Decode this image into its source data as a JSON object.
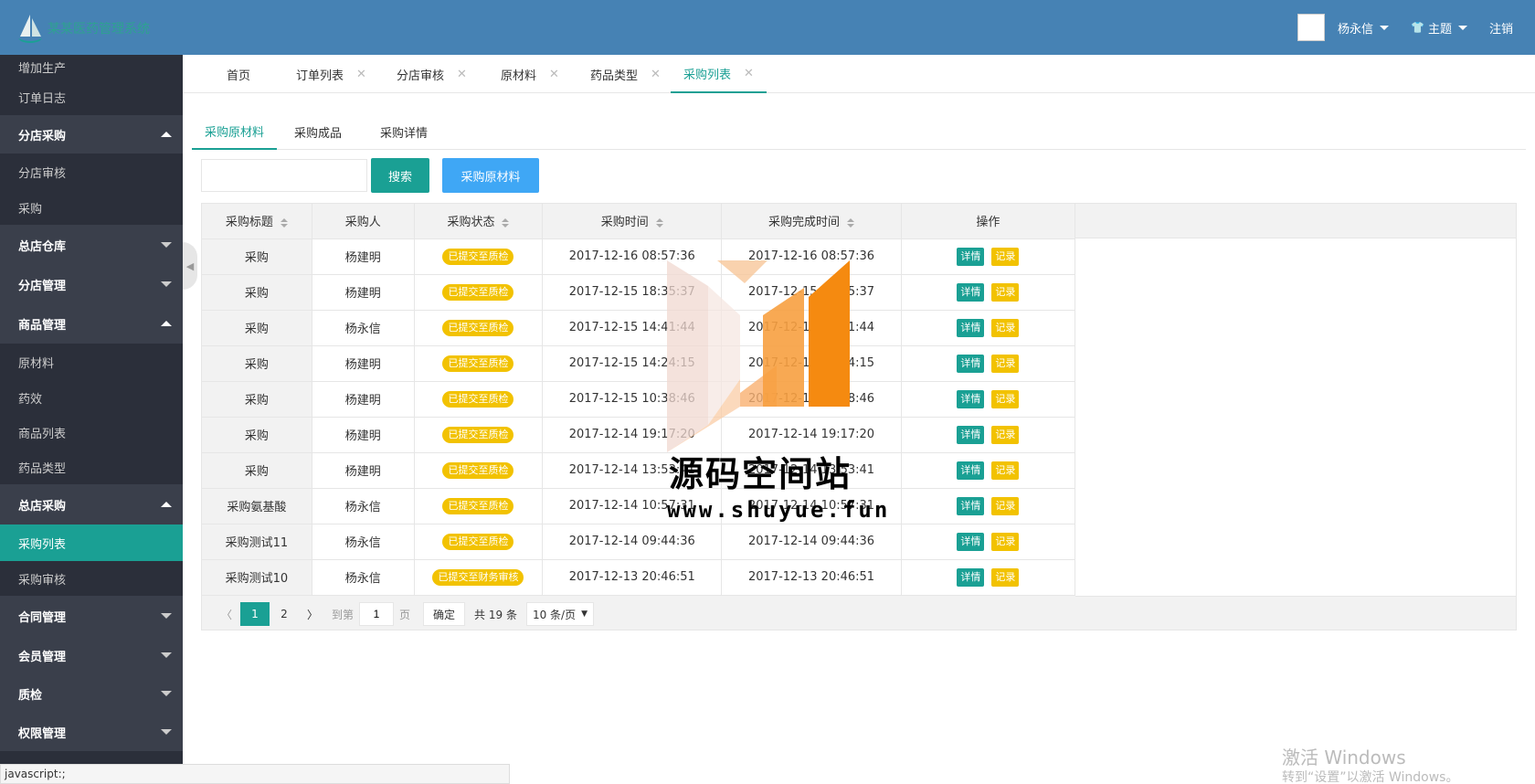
{
  "header": {
    "app_title": "某某医药管理系统",
    "user_name": "杨永信",
    "theme_label": "主题",
    "logout_label": "注销"
  },
  "sidebar": {
    "items": [
      {
        "label": "增加生产",
        "kind": "sub"
      },
      {
        "label": "订单日志",
        "kind": "sub"
      },
      {
        "label": "分店采购",
        "kind": "group",
        "expanded": true
      },
      {
        "label": "分店审核",
        "kind": "sub"
      },
      {
        "label": "采购",
        "kind": "sub"
      },
      {
        "label": "总店仓库",
        "kind": "group",
        "expanded": false
      },
      {
        "label": "分店管理",
        "kind": "group",
        "expanded": false
      },
      {
        "label": "商品管理",
        "kind": "group",
        "expanded": true
      },
      {
        "label": "原材料",
        "kind": "sub"
      },
      {
        "label": "药效",
        "kind": "sub"
      },
      {
        "label": "商品列表",
        "kind": "sub"
      },
      {
        "label": "药品类型",
        "kind": "sub"
      },
      {
        "label": "总店采购",
        "kind": "group",
        "expanded": true
      },
      {
        "label": "采购列表",
        "kind": "active"
      },
      {
        "label": "采购审核",
        "kind": "sub"
      },
      {
        "label": "合同管理",
        "kind": "group",
        "expanded": false
      },
      {
        "label": "会员管理",
        "kind": "group",
        "expanded": false
      },
      {
        "label": "质检",
        "kind": "group",
        "expanded": false
      },
      {
        "label": "权限管理",
        "kind": "group",
        "expanded": false
      }
    ]
  },
  "tabs": [
    {
      "label": "首页",
      "closable": false
    },
    {
      "label": "订单列表",
      "closable": true
    },
    {
      "label": "分店审核",
      "closable": true
    },
    {
      "label": "原材料",
      "closable": true
    },
    {
      "label": "药品类型",
      "closable": true
    },
    {
      "label": "采购列表",
      "closable": true,
      "active": true
    }
  ],
  "subtabs": [
    {
      "label": "采购原材料",
      "active": true
    },
    {
      "label": "采购成品"
    },
    {
      "label": "采购详情"
    }
  ],
  "toolbar": {
    "search_value": "",
    "search_button": "搜索",
    "buy_button": "采购原材料"
  },
  "table": {
    "headers": [
      "采购标题",
      "采购人",
      "采购状态",
      "采购时间",
      "采购完成时间",
      "操作"
    ],
    "rows": [
      {
        "title": "采购",
        "buyer": "杨建明",
        "status": "已提交至质检",
        "time": "2017-12-16 08:57:36",
        "done": "2017-12-16 08:57:36"
      },
      {
        "title": "采购",
        "buyer": "杨建明",
        "status": "已提交至质检",
        "time": "2017-12-15 18:35:37",
        "done": "2017-12-15 18:35:37"
      },
      {
        "title": "采购",
        "buyer": "杨永信",
        "status": "已提交至质检",
        "time": "2017-12-15 14:41:44",
        "done": "2017-12-15 14:41:44"
      },
      {
        "title": "采购",
        "buyer": "杨建明",
        "status": "已提交至质检",
        "time": "2017-12-15 14:24:15",
        "done": "2017-12-15 14:24:15"
      },
      {
        "title": "采购",
        "buyer": "杨建明",
        "status": "已提交至质检",
        "time": "2017-12-15 10:38:46",
        "done": "2017-12-15 10:38:46"
      },
      {
        "title": "采购",
        "buyer": "杨建明",
        "status": "已提交至质检",
        "time": "2017-12-14 19:17:20",
        "done": "2017-12-14 19:17:20"
      },
      {
        "title": "采购",
        "buyer": "杨建明",
        "status": "已提交至质检",
        "time": "2017-12-14 13:53:41",
        "done": "2017-12-14 13:53:41"
      },
      {
        "title": "采购氨基酸",
        "buyer": "杨永信",
        "status": "已提交至质检",
        "time": "2017-12-14 10:57:31",
        "done": "2017-12-14 10:57:31"
      },
      {
        "title": "采购测试11",
        "buyer": "杨永信",
        "status": "已提交至质检",
        "time": "2017-12-14 09:44:36",
        "done": "2017-12-14 09:44:36"
      },
      {
        "title": "采购测试10",
        "buyer": "杨永信",
        "status": "已提交至财务审核",
        "time": "2017-12-13 20:46:51",
        "done": "2017-12-13 20:46:51"
      }
    ],
    "op_detail": "详情",
    "op_record": "记录"
  },
  "pager": {
    "pages": [
      "1",
      "2"
    ],
    "current": "1",
    "goto_label": "到第",
    "goto_value": "1",
    "page_unit": "页",
    "confirm": "确定",
    "total": "共 19 条",
    "page_size": "10 条/页"
  },
  "watermark": {
    "line1": "源码空间站",
    "line2": "www.shuyue.fun"
  },
  "status_bar": "javascript:;",
  "windows_activate": {
    "line1": "激活 Windows",
    "line2": "转到“设置”以激活 Windows。"
  },
  "colors": {
    "header": "#4682b4",
    "sidebar": "#2b2f3a",
    "accent": "#1aa094",
    "badge": "#f2c200",
    "blue_button": "#3fa7f5"
  }
}
